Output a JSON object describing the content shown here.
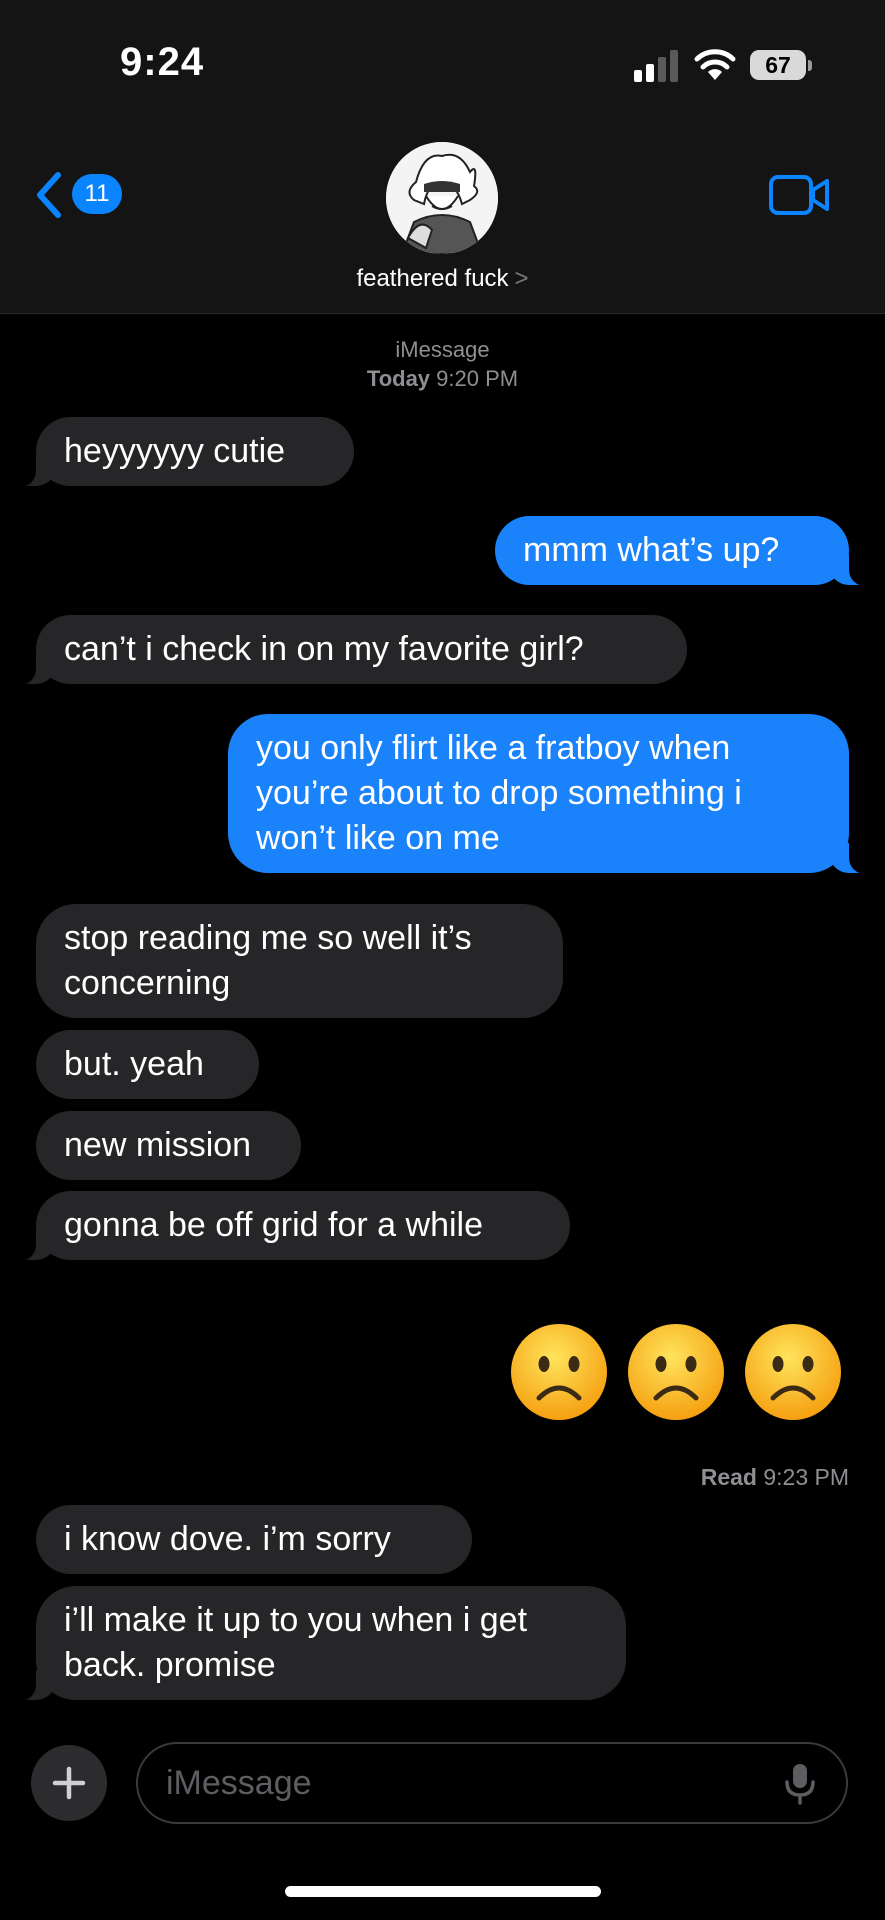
{
  "status": {
    "time": "9:24",
    "battery": "67"
  },
  "header": {
    "back_count": "11",
    "contact_name": "feathered fuck",
    "chevron": ">"
  },
  "meta": {
    "service": "iMessage",
    "date_bold": "Today",
    "date_time": "9:20 PM"
  },
  "messages": [
    {
      "dir": "in",
      "text": "heyyyyyy cutie"
    },
    {
      "dir": "out",
      "text": "mmm what’s up?"
    },
    {
      "dir": "in",
      "text": "can’t i check in on my favorite girl?"
    },
    {
      "dir": "out",
      "text": "you only flirt like a fratboy when you’re about to drop something i won’t like on me"
    },
    {
      "dir": "in",
      "text": "stop reading me so well it’s concerning"
    },
    {
      "dir": "in",
      "text": "but. yeah"
    },
    {
      "dir": "in",
      "text": "new mission"
    },
    {
      "dir": "in",
      "text": "gonna be off grid for a while"
    },
    {
      "dir": "out",
      "emoji": "frowning-face",
      "count": 3
    },
    {
      "dir": "in",
      "text": "i know dove. i’m sorry"
    },
    {
      "dir": "in",
      "text": "i’ll make it up to you when i get back. promise"
    }
  ],
  "read_receipt": {
    "label": "Read",
    "time": "9:23 PM"
  },
  "composer": {
    "placeholder": "iMessage"
  },
  "colors": {
    "incoming": "#262628",
    "outgoing": "#1a82fb",
    "accent": "#0a84ff"
  }
}
